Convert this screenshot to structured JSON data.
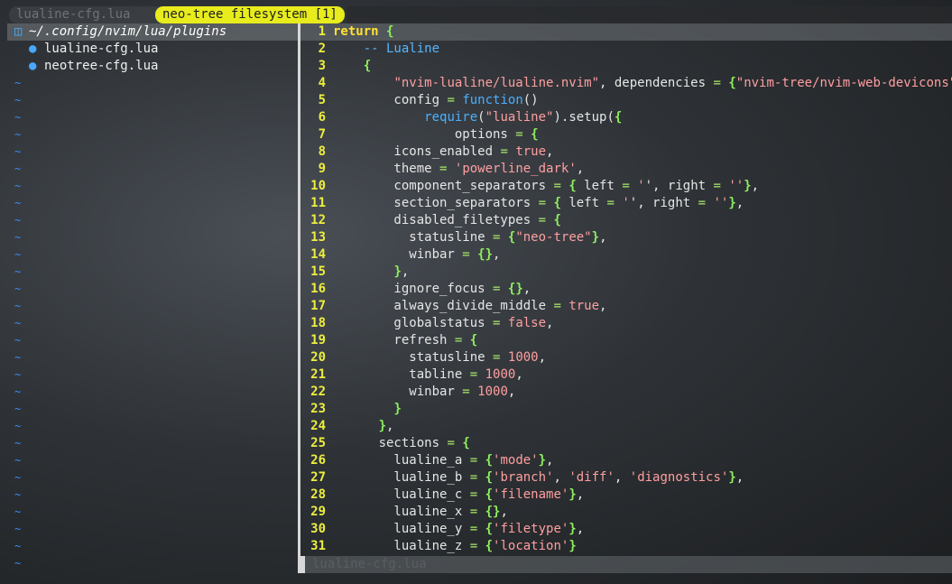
{
  "tabline": {
    "inactive_tab": "lualine-cfg.lua",
    "active_tab": "neo-tree filesystem [1]"
  },
  "tree": {
    "root_path": "~/.config/nvim/lua/plugins",
    "files": [
      "lualine-cfg.lua",
      "neotree-cfg.lua"
    ],
    "empty_marker": "~"
  },
  "editor": {
    "line_numbers": [
      "1",
      "2",
      "3",
      "4",
      "5",
      "6",
      "7",
      "8",
      "9",
      "10",
      "11",
      "12",
      "13",
      "14",
      "15",
      "16",
      "17",
      "18",
      "19",
      "20",
      "21",
      "22",
      "23",
      "24",
      "25",
      "26",
      "27",
      "28",
      "29",
      "30",
      "31"
    ],
    "tokens": {
      "l1_kw": "return",
      "l1_br": " {",
      "l2_cm": "    -- Lualine",
      "l3_br": "    {",
      "l4_a": "        ",
      "l4_s1": "\"nvim-lualine/lualine.nvim\"",
      "l4_b": ", dependencies ",
      "l4_eq": "=",
      "l4_c": " ",
      "l4_br1": "{",
      "l4_s2": "\"nvim-tree/nvim-web-devicons\"",
      "l4_br2": "}",
      "l4_d": ",",
      "l5_a": "        config ",
      "l5_eq": "=",
      "l5_b": " ",
      "l5_fn": "function",
      "l5_c": "()",
      "l6_a": "            ",
      "l6_fn": "require",
      "l6_b": "(",
      "l6_s": "\"lualine\"",
      "l6_c": ").setup(",
      "l6_br": "{",
      "l7_a": "                options ",
      "l7_eq": "=",
      "l7_b": " ",
      "l7_br": "{",
      "l8_a": "        icons_enabled ",
      "l8_eq": "=",
      "l8_b": " ",
      "l8_v": "true",
      "l8_c": ",",
      "l9_a": "        theme ",
      "l9_eq": "=",
      "l9_b": " ",
      "l9_s": "'powerline_dark'",
      "l9_c": ",",
      "l10_a": "        component_separators ",
      "l10_eq": "=",
      "l10_b": " ",
      "l10_br1": "{",
      "l10_c": " left ",
      "l10_eq2": "=",
      "l10_d": " '",
      "l10_sep1": "",
      "l10_e": "', right ",
      "l10_eq3": "=",
      "l10_f": " '",
      "l10_sep2": "",
      "l10_g": "'",
      "l10_br2": "}",
      "l10_h": ",",
      "l11_a": "        section_separators ",
      "l11_eq": "=",
      "l11_b": " ",
      "l11_br1": "{",
      "l11_c": " left ",
      "l11_eq2": "=",
      "l11_d": " '",
      "l11_sep1": "",
      "l11_e": "', right ",
      "l11_eq3": "=",
      "l11_f": " '",
      "l11_sep2": "",
      "l11_g": "'",
      "l11_br2": "}",
      "l11_h": ",",
      "l12_a": "        disabled_filetypes ",
      "l12_eq": "=",
      "l12_b": " ",
      "l12_br": "{",
      "l13_a": "          statusline ",
      "l13_eq": "=",
      "l13_b": " ",
      "l13_br1": "{",
      "l13_s": "\"neo-tree\"",
      "l13_br2": "}",
      "l13_c": ",",
      "l14_a": "          winbar ",
      "l14_eq": "=",
      "l14_b": " ",
      "l14_br": "{}",
      "l14_c": ",",
      "l15_a": "        ",
      "l15_br": "}",
      "l15_b": ",",
      "l16_a": "        ignore_focus ",
      "l16_eq": "=",
      "l16_b": " ",
      "l16_br": "{}",
      "l16_c": ",",
      "l17_a": "        always_divide_middle ",
      "l17_eq": "=",
      "l17_b": " ",
      "l17_v": "true",
      "l17_c": ",",
      "l18_a": "        globalstatus ",
      "l18_eq": "=",
      "l18_b": " ",
      "l18_v": "false",
      "l18_c": ",",
      "l19_a": "        refresh ",
      "l19_eq": "=",
      "l19_b": " ",
      "l19_br": "{",
      "l20_a": "          statusline ",
      "l20_eq": "=",
      "l20_b": " ",
      "l20_v": "1000",
      "l20_c": ",",
      "l21_a": "          tabline ",
      "l21_eq": "=",
      "l21_b": " ",
      "l21_v": "1000",
      "l21_c": ",",
      "l22_a": "          winbar ",
      "l22_eq": "=",
      "l22_b": " ",
      "l22_v": "1000",
      "l22_c": ",",
      "l23_a": "        ",
      "l23_br": "}",
      "l24_a": "      ",
      "l24_br": "}",
      "l24_b": ",",
      "l25_a": "      sections ",
      "l25_eq": "=",
      "l25_b": " ",
      "l25_br": "{",
      "l26_a": "        lualine_a ",
      "l26_eq": "=",
      "l26_b": " ",
      "l26_br1": "{",
      "l26_s": "'mode'",
      "l26_br2": "}",
      "l26_c": ",",
      "l27_a": "        lualine_b ",
      "l27_eq": "=",
      "l27_b": " ",
      "l27_br1": "{",
      "l27_s1": "'branch'",
      "l27_c": ", ",
      "l27_s2": "'diff'",
      "l27_d": ", ",
      "l27_s3": "'diagnostics'",
      "l27_br2": "}",
      "l27_e": ",",
      "l28_a": "        lualine_c ",
      "l28_eq": "=",
      "l28_b": " ",
      "l28_br1": "{",
      "l28_s": "'filename'",
      "l28_br2": "}",
      "l28_c": ",",
      "l29_a": "        lualine_x ",
      "l29_eq": "=",
      "l29_b": " ",
      "l29_br": "{}",
      "l29_c": ",",
      "l30_a": "        lualine_y ",
      "l30_eq": "=",
      "l30_b": " ",
      "l30_br1": "{",
      "l30_s": "'filetype'",
      "l30_br2": "}",
      "l30_c": ",",
      "l31_a": "        lualine_z ",
      "l31_eq": "=",
      "l31_b": " ",
      "l31_br1": "{",
      "l31_s": "'location'",
      "l31_br2": "}"
    }
  },
  "statusbar": {
    "filename": "lualine-cfg.lua"
  },
  "icons": {
    "folder": "folder-open-icon",
    "file": "lua-file-icon"
  },
  "colors": {
    "active_tab": "#e8ec1c",
    "line_number": "#ecee3e",
    "keyword": "#ffe135",
    "string": "#ff9fa0",
    "bracket": "#8ef05e",
    "function": "#49b0ff"
  }
}
